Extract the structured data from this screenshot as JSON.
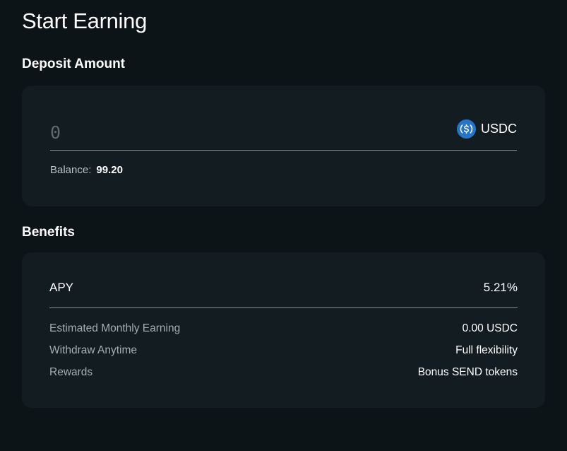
{
  "page": {
    "title": "Start Earning"
  },
  "deposit": {
    "heading": "Deposit Amount",
    "amount_placeholder": "0",
    "currency": {
      "label": "USDC",
      "icon": "usdc-coin-icon",
      "icon_color": "#2775ca"
    },
    "balance_label": "Balance:",
    "balance_value": "99.20"
  },
  "benefits": {
    "heading": "Benefits",
    "apy": {
      "label": "APY",
      "value": "5.21%"
    },
    "rows": [
      {
        "label": "Estimated Monthly Earning",
        "value": "0.00 USDC"
      },
      {
        "label": "Withdraw Anytime",
        "value": "Full flexibility"
      },
      {
        "label": "Rewards",
        "value": "Bonus SEND tokens"
      }
    ]
  },
  "colors": {
    "background": "#0c1417",
    "card": "#131d21",
    "divider": "#8a9498",
    "muted_text": "#a4adb1"
  }
}
